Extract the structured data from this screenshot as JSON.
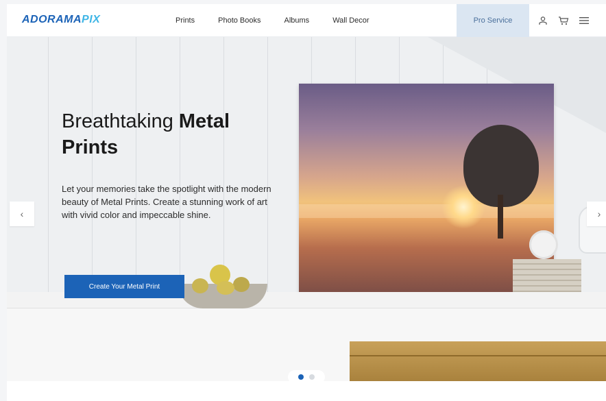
{
  "brand": {
    "logo_main": "ADORAMA",
    "logo_accent": "PIX"
  },
  "nav": {
    "items": [
      "Prints",
      "Photo Books",
      "Albums",
      "Wall Decor"
    ],
    "pro_service": "Pro Service",
    "icons": [
      "user-icon",
      "cart-icon",
      "menu-icon"
    ]
  },
  "hero": {
    "headline_regular": "Breathtaking ",
    "headline_bold_1": "Metal",
    "headline_bold_2": "Prints",
    "body": "Let your memories take the spotlight with the modern beauty of Metal Prints. Create a stunning work of art with vivid color and impeccable shine.",
    "cta": "Create Your Metal Print",
    "prev_arrow": "‹",
    "next_arrow": "›"
  },
  "carousel": {
    "slides": 2,
    "active_index": 0
  },
  "colors": {
    "accent": "#1c63b7",
    "pro_bg": "#dbe6f2"
  }
}
